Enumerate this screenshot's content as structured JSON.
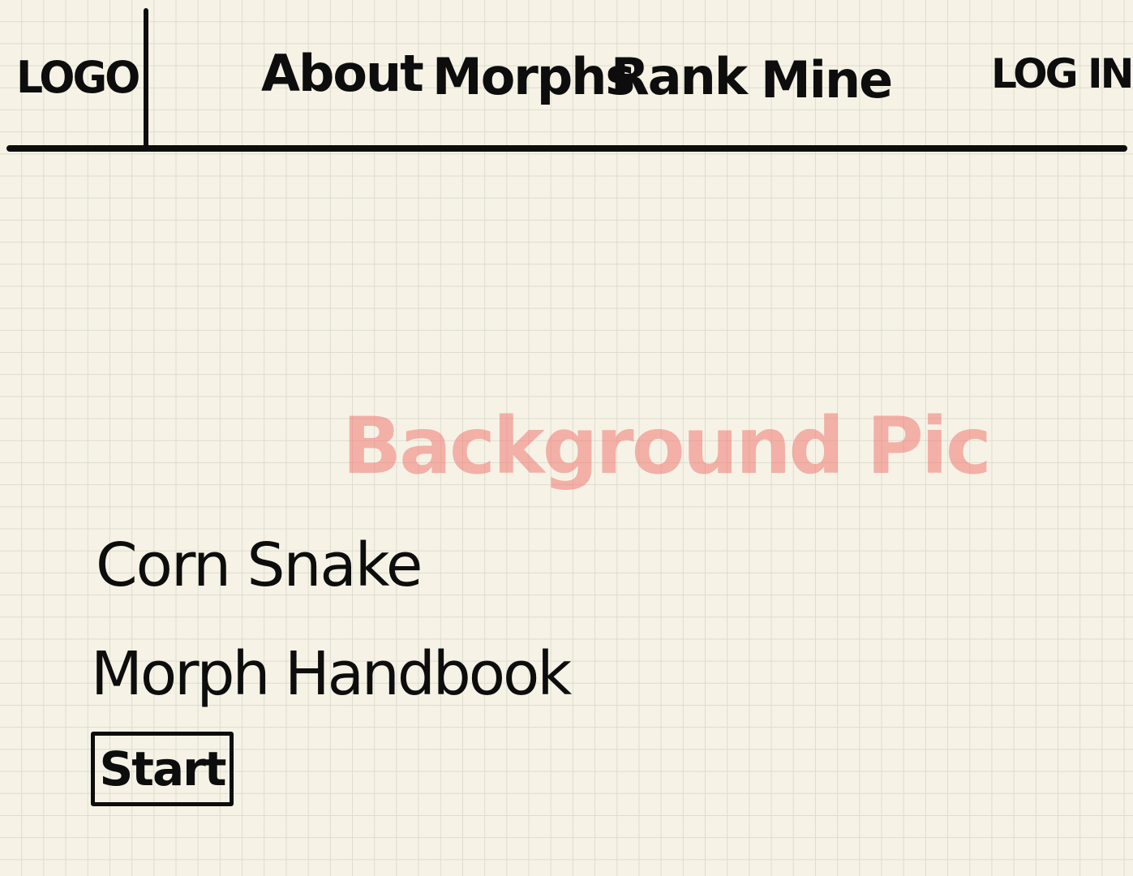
{
  "header": {
    "logo_text": "LOGO",
    "nav_items": [
      {
        "label": "About"
      },
      {
        "label": "Morphs"
      },
      {
        "label": "Rank"
      },
      {
        "label": "Mine"
      }
    ],
    "login_label": "LOG IN"
  },
  "hero": {
    "background_label": "Background Pic",
    "title": "Corn Snake",
    "subtitle": "Morph Handbook",
    "start_label": "Start"
  },
  "colors": {
    "paper": "#f6f3e6",
    "grid": "#dcdccf",
    "ink": "#0d0d0d",
    "background_label": "#f0787380"
  }
}
